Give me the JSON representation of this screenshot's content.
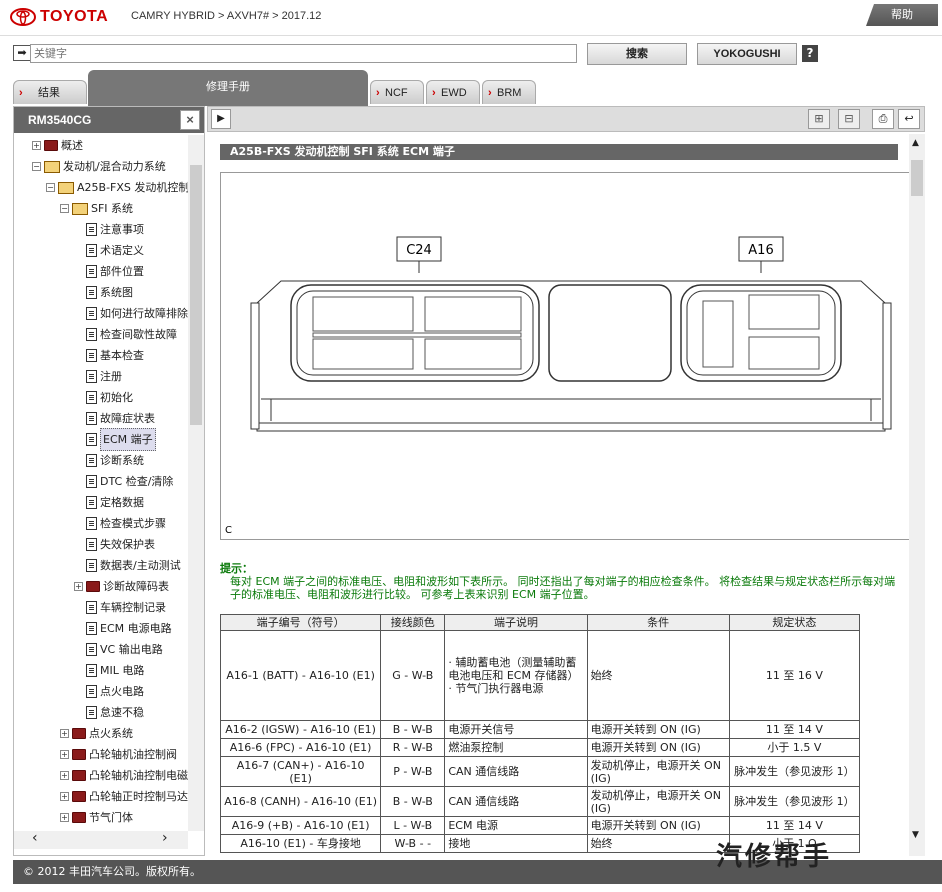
{
  "header": {
    "brand": "TOYOTA",
    "crumb": "CAMRY HYBRID > AXVH7# > 2017.12",
    "help": "帮助"
  },
  "search": {
    "placeholder": "关键字",
    "search_btn": "搜索",
    "yoko_btn": "YOKOGUSHI",
    "q": "?"
  },
  "tabs": [
    {
      "label": "结果"
    },
    {
      "label": "修理手册"
    },
    {
      "label": "NCF"
    },
    {
      "label": "EWD"
    },
    {
      "label": "BRM"
    }
  ],
  "left": {
    "title": "RM3540CG",
    "close": "×",
    "tree": [
      {
        "label": "概述",
        "indent": 0,
        "exp": "+",
        "icon": "bk"
      },
      {
        "label": "发动机/混合动力系统",
        "indent": 0,
        "exp": "−",
        "icon": "bko"
      },
      {
        "label": "A25B-FXS 发动机控制",
        "indent": 1,
        "exp": "−",
        "icon": "bko"
      },
      {
        "label": "SFI 系统",
        "indent": 2,
        "exp": "−",
        "icon": "bko"
      },
      {
        "label": "注意事项",
        "indent": 3,
        "icon": "doc"
      },
      {
        "label": "术语定义",
        "indent": 3,
        "icon": "doc"
      },
      {
        "label": "部件位置",
        "indent": 3,
        "icon": "doc"
      },
      {
        "label": "系统图",
        "indent": 3,
        "icon": "doc"
      },
      {
        "label": "如何进行故障排除",
        "indent": 3,
        "icon": "doc"
      },
      {
        "label": "检查间歇性故障",
        "indent": 3,
        "icon": "doc"
      },
      {
        "label": "基本检查",
        "indent": 3,
        "icon": "doc"
      },
      {
        "label": "注册",
        "indent": 3,
        "icon": "doc"
      },
      {
        "label": "初始化",
        "indent": 3,
        "icon": "doc"
      },
      {
        "label": "故障症状表",
        "indent": 3,
        "icon": "doc"
      },
      {
        "label": "ECM 端子",
        "indent": 3,
        "icon": "doc",
        "selected": true
      },
      {
        "label": "诊断系统",
        "indent": 3,
        "icon": "doc"
      },
      {
        "label": "DTC 检查/清除",
        "indent": 3,
        "icon": "doc"
      },
      {
        "label": "定格数据",
        "indent": 3,
        "icon": "doc"
      },
      {
        "label": "检查模式步骤",
        "indent": 3,
        "icon": "doc"
      },
      {
        "label": "失效保护表",
        "indent": 3,
        "icon": "doc"
      },
      {
        "label": "数据表/主动测试",
        "indent": 3,
        "icon": "doc"
      },
      {
        "label": "诊断故障码表",
        "indent": 3,
        "exp": "+",
        "icon": "bk"
      },
      {
        "label": "车辆控制记录",
        "indent": 3,
        "icon": "doc"
      },
      {
        "label": "ECM 电源电路",
        "indent": 3,
        "icon": "doc"
      },
      {
        "label": "VC 输出电路",
        "indent": 3,
        "icon": "doc"
      },
      {
        "label": "MIL 电路",
        "indent": 3,
        "icon": "doc"
      },
      {
        "label": "点火电路",
        "indent": 3,
        "icon": "doc"
      },
      {
        "label": "怠速不稳",
        "indent": 3,
        "icon": "doc"
      },
      {
        "label": "点火系统",
        "indent": 2,
        "exp": "+",
        "icon": "bk"
      },
      {
        "label": "凸轮轴机油控制阀",
        "indent": 2,
        "exp": "+",
        "icon": "bk"
      },
      {
        "label": "凸轮轴机油控制电磁",
        "indent": 2,
        "exp": "+",
        "icon": "bk"
      },
      {
        "label": "凸轮轴正时控制马达",
        "indent": 2,
        "exp": "+",
        "icon": "bk"
      },
      {
        "label": "节气门体",
        "indent": 2,
        "exp": "+",
        "icon": "bk"
      }
    ]
  },
  "content": {
    "title": "A25B-FXS 发动机控制  SFI 系统  ECM 端子",
    "conn_left": "C24",
    "conn_right": "A16",
    "corner": "C",
    "note_title": "提示：",
    "note_body": "每对 ECM 端子之间的标准电压、电阻和波形如下表所示。 同时还指出了每对端子的相应检查条件。 将检查结果与规定状态栏所示每对端子的标准电压、电阻和波形进行比较。 可参考上表来识别 ECM 端子位置。",
    "table": {
      "headers": [
        "端子编号（符号）",
        "接线颜色",
        "端子说明",
        "条件",
        "规定状态"
      ],
      "rows": [
        [
          "A16-1 (BATT) - A16-10 (E1)",
          "G - W-B",
          "· 辅助蓄电池（测量辅助蓄电池电压和 ECM 存储器）\n· 节气门执行器电源",
          "始终",
          "11 至 16 V"
        ],
        [
          "A16-2 (IGSW) - A16-10 (E1)",
          "B - W-B",
          "电源开关信号",
          "电源开关转到 ON (IG)",
          "11 至 14 V"
        ],
        [
          "A16-6 (FPC) - A16-10 (E1)",
          "R - W-B",
          "燃油泵控制",
          "电源开关转到 ON (IG)",
          "小于 1.5 V"
        ],
        [
          "A16-7 (CAN+) - A16-10 (E1)",
          "P - W-B",
          "CAN 通信线路",
          "发动机停止，电源开关 ON (IG)",
          "脉冲发生（参见波形 1）"
        ],
        [
          "A16-8 (CANH) - A16-10 (E1)",
          "B - W-B",
          "CAN 通信线路",
          "发动机停止，电源开关 ON (IG)",
          "脉冲发生（参见波形 1）"
        ],
        [
          "A16-9 (+B) - A16-10 (E1)",
          "L - W-B",
          "ECM 电源",
          "电源开关转到 ON (IG)",
          "11 至 14 V"
        ],
        [
          "A16-10 (E1) - 车身接地",
          "W-B - -",
          "接地",
          "始终",
          "小于 1 Ω"
        ]
      ]
    }
  },
  "footer": {
    "copyright": "© 2012 丰田汽车公司。版权所有。"
  },
  "watermark": "汽修帮手"
}
